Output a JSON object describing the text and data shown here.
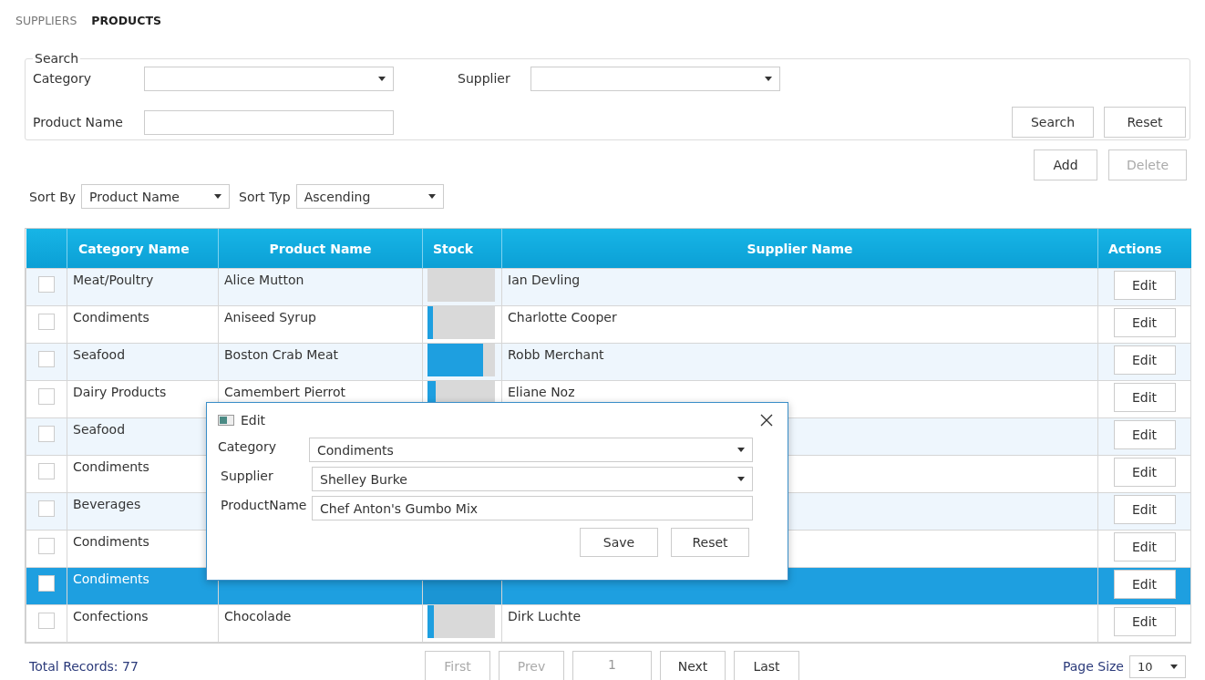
{
  "tabs": [
    {
      "label": "SUPPLIERS",
      "selected": false
    },
    {
      "label": "PRODUCTS",
      "selected": true
    }
  ],
  "search": {
    "legend": "Search",
    "fields": [
      {
        "label": "Category",
        "kind": "dropdown"
      },
      {
        "label": "Supplier",
        "kind": "dropdown"
      },
      {
        "label": "Product Name",
        "kind": "text"
      }
    ],
    "buttons": [
      "Search",
      "Reset"
    ]
  },
  "actions": [
    {
      "label": "Add",
      "disabled": false
    },
    {
      "label": "Delete",
      "disabled": true
    }
  ],
  "sort": [
    {
      "label": "Sort By",
      "value": "Product Name"
    },
    {
      "label": "Sort Typ",
      "value": "Ascending"
    }
  ],
  "table": {
    "columns": [
      "Category Name",
      "Product Name",
      "Stock",
      "Supplier Name",
      "Actions"
    ],
    "rows": [
      {
        "checked": false,
        "selected": false,
        "category": "Meat/Poultry",
        "product": "Alice Mutton",
        "level": 0,
        "supplier": "Ian Devling",
        "action": "Edit"
      },
      {
        "checked": false,
        "selected": false,
        "category": "Condiments",
        "product": "Aniseed Syrup",
        "level": 0.08,
        "supplier": "Charlotte Cooper",
        "action": "Edit"
      },
      {
        "checked": false,
        "selected": false,
        "category": "Seafood",
        "product": "Boston Crab Meat",
        "level": 0.82,
        "supplier": "Robb Merchant",
        "action": "Edit"
      },
      {
        "checked": false,
        "selected": false,
        "category": "Dairy Products",
        "product": "Camembert Pierrot",
        "level": 0.12,
        "supplier": "Eliane Noz",
        "action": "Edit"
      },
      {
        "checked": false,
        "selected": false,
        "category": "Seafood",
        "action": "Edit"
      },
      {
        "checked": false,
        "selected": false,
        "category": "Condiments",
        "action": "Edit"
      },
      {
        "checked": false,
        "selected": false,
        "category": "Beverages",
        "action": "Edit"
      },
      {
        "checked": false,
        "selected": false,
        "category": "Condiments",
        "action": "Edit"
      },
      {
        "checked": false,
        "selected": true,
        "category": "Condiments",
        "action": "Edit"
      },
      {
        "checked": false,
        "selected": false,
        "category": "Confections",
        "product": "Chocolade",
        "level": 0.1,
        "supplier": "Dirk Luchte",
        "action": "Edit"
      }
    ]
  },
  "dialog": {
    "title": "Edit",
    "fields": [
      {
        "label": "Category",
        "kind": "dropdown",
        "value": "Condiments"
      },
      {
        "label": "Supplier",
        "kind": "dropdown",
        "value": "Shelley Burke"
      },
      {
        "label": "ProductName",
        "kind": "text",
        "value": "Chef Anton's Gumbo Mix"
      }
    ],
    "buttons": [
      "Save",
      "Reset"
    ]
  },
  "footer": {
    "total": "Total Records: 77",
    "pager": [
      {
        "label": "First",
        "disabled": true
      },
      {
        "label": "Prev",
        "disabled": true
      },
      {
        "label": "1",
        "kind": "page"
      },
      {
        "label": "Next",
        "disabled": false
      },
      {
        "label": "Last",
        "disabled": false
      }
    ],
    "page_size_label": "Page Size",
    "page_size": "10"
  }
}
